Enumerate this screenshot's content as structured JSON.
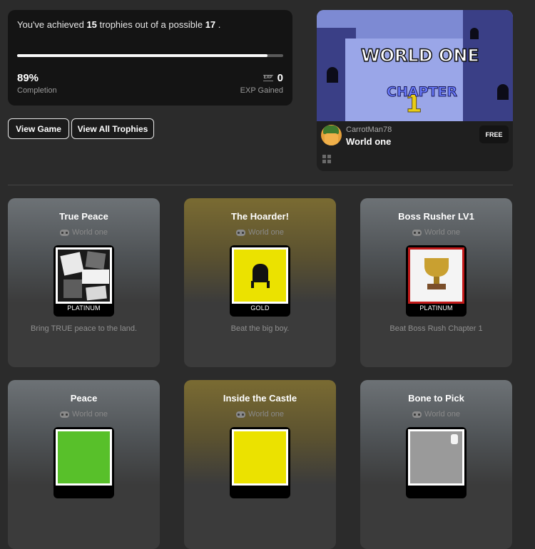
{
  "summary": {
    "prefix": "You've achieved",
    "achieved": "15",
    "middle": "trophies out of a possible",
    "total": "17",
    "suffix": ".",
    "progress_fraction": 0.94,
    "completion_value": "89%",
    "completion_label": "Completion",
    "exp_icon": "EXP",
    "exp_value": "0",
    "exp_label": "EXP Gained"
  },
  "buttons": {
    "view_game": "View Game",
    "view_all": "View All Trophies"
  },
  "game": {
    "logo_word": "WORLD ONE",
    "logo_chapter": "CHAPTER",
    "logo_number": "1",
    "creator": "CarrotMan78",
    "title": "World one",
    "price_badge": "FREE",
    "grid_icon": "grid-icon"
  },
  "trophies": [
    {
      "name": "True Peace",
      "game": "World one",
      "tier": "PLATINUM",
      "description": "Bring TRUE peace to the land.",
      "art": "comic-panels"
    },
    {
      "name": "The Hoarder!",
      "game": "World one",
      "tier": "GOLD",
      "description": "Beat the big boy.",
      "art": "black-creature"
    },
    {
      "name": "Boss Rusher LV1",
      "game": "World one",
      "tier": "PLATINUM",
      "description": "Beat Boss Rush Chapter 1",
      "art": "gold-trophy"
    },
    {
      "name": "Peace",
      "game": "World one",
      "tier": "",
      "description": "",
      "art": "green"
    },
    {
      "name": "Inside the Castle",
      "game": "World one",
      "tier": "",
      "description": "",
      "art": "yellow"
    },
    {
      "name": "Bone to Pick",
      "game": "World one",
      "tier": "",
      "description": "",
      "art": "gray-bone"
    }
  ],
  "colors": {
    "background": "#2b2b2b",
    "panel": "#141414",
    "platinum_card_top": "#6d7276",
    "gold_card_top": "#7a6b32",
    "muted_text": "#8f8f8f"
  }
}
